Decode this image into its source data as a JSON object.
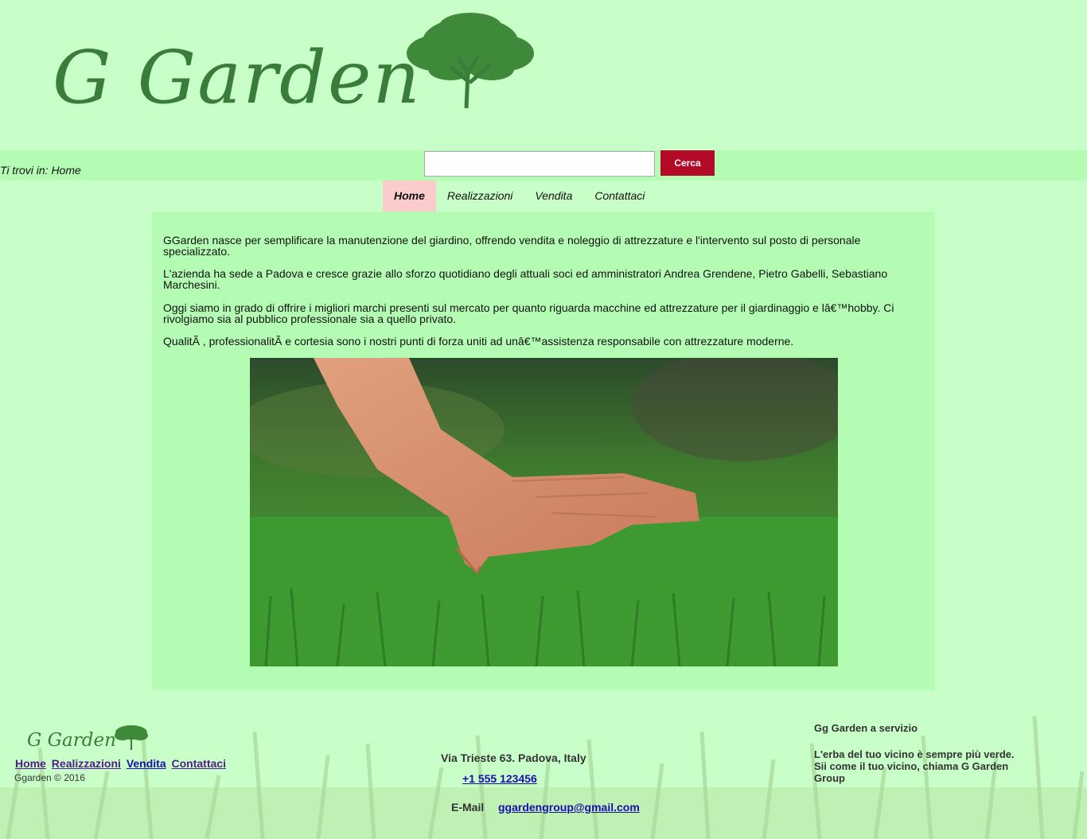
{
  "header": {
    "logo_text": "G Garden"
  },
  "breadcrumb": "Ti trovi in: Home",
  "search": {
    "placeholder": "",
    "button_label": "Cerca"
  },
  "nav": {
    "items": [
      {
        "label": "Home",
        "active": true
      },
      {
        "label": "Realizzazioni",
        "active": false
      },
      {
        "label": "Vendita",
        "active": false
      },
      {
        "label": "Contattaci",
        "active": false
      }
    ]
  },
  "content": {
    "paragraphs": [
      "GGarden nasce per semplificare la manutenzione del giardino, offrendo vendita e noleggio di attrezzature e l'intervento sul posto di personale specializzato.",
      "L'azienda ha sede a Padova e cresce grazie allo sforzo quotidiano degli attuali soci ed amministratori Andrea Grendene, Pietro Gabelli, Sebastiano Marchesini.",
      "Oggi siamo in grado di offrire i migliori marchi presenti sul mercato per quanto riguarda macchine ed attrezzature per il giardinaggio e lâ€™hobby. Ci rivolgiamo sia al pubblico professionale sia a quello privato.",
      "QualitÃ , professionalitÃ  e cortesia sono i nostri punti di forza uniti ad unâ€™assistenza responsabile con attrezzature moderne."
    ],
    "image_icon": "hand-on-grass-photo"
  },
  "footer": {
    "logo_text": "G Garden",
    "links": [
      "Home",
      "Realizzazioni",
      "Vendita",
      "Contattaci"
    ],
    "copyright": "Ggarden © 2016",
    "address": "Via Trieste 63. Padova, Italy",
    "phone": "+1 555 123456",
    "email_label": "E-Mail",
    "email": "ggardengroup@gmail.com",
    "tagline_title": "Gg Garden a servizio",
    "tagline_text": "L'erba del tuo vicino è sempre più verde. Sii come il tuo vicino, chiama G Garden Group"
  },
  "colors": {
    "page_bg": "#c8fec8",
    "bar_bg": "#b4fcb4",
    "brand_green": "#3a7d3a",
    "search_button": "#b30a28",
    "nav_active": "#fccbcb"
  }
}
